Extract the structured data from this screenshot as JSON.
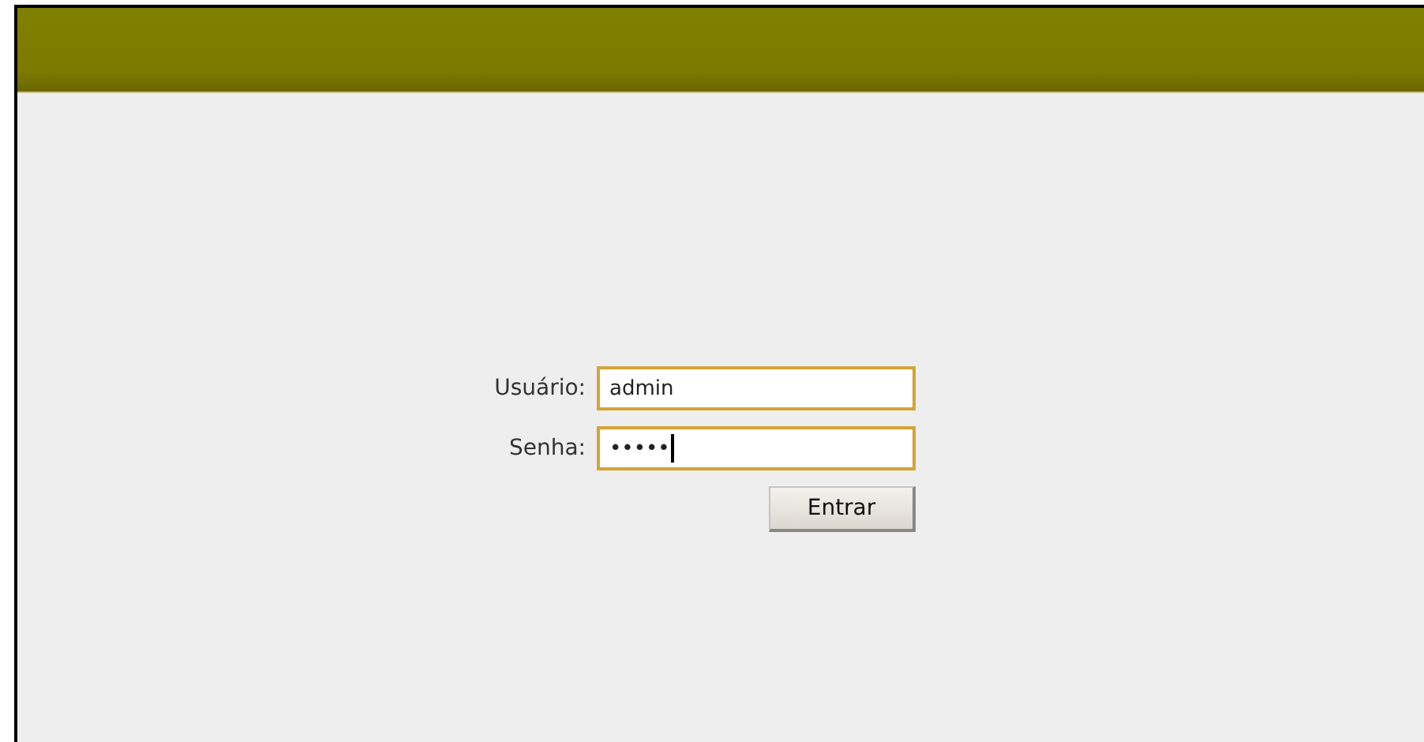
{
  "login_form": {
    "fields": [
      {
        "label": "Usuário:",
        "value": "admin",
        "focused": false
      },
      {
        "label": "Senha:",
        "value": "•••••",
        "focused": true
      }
    ],
    "submit_button": "Entrar"
  }
}
